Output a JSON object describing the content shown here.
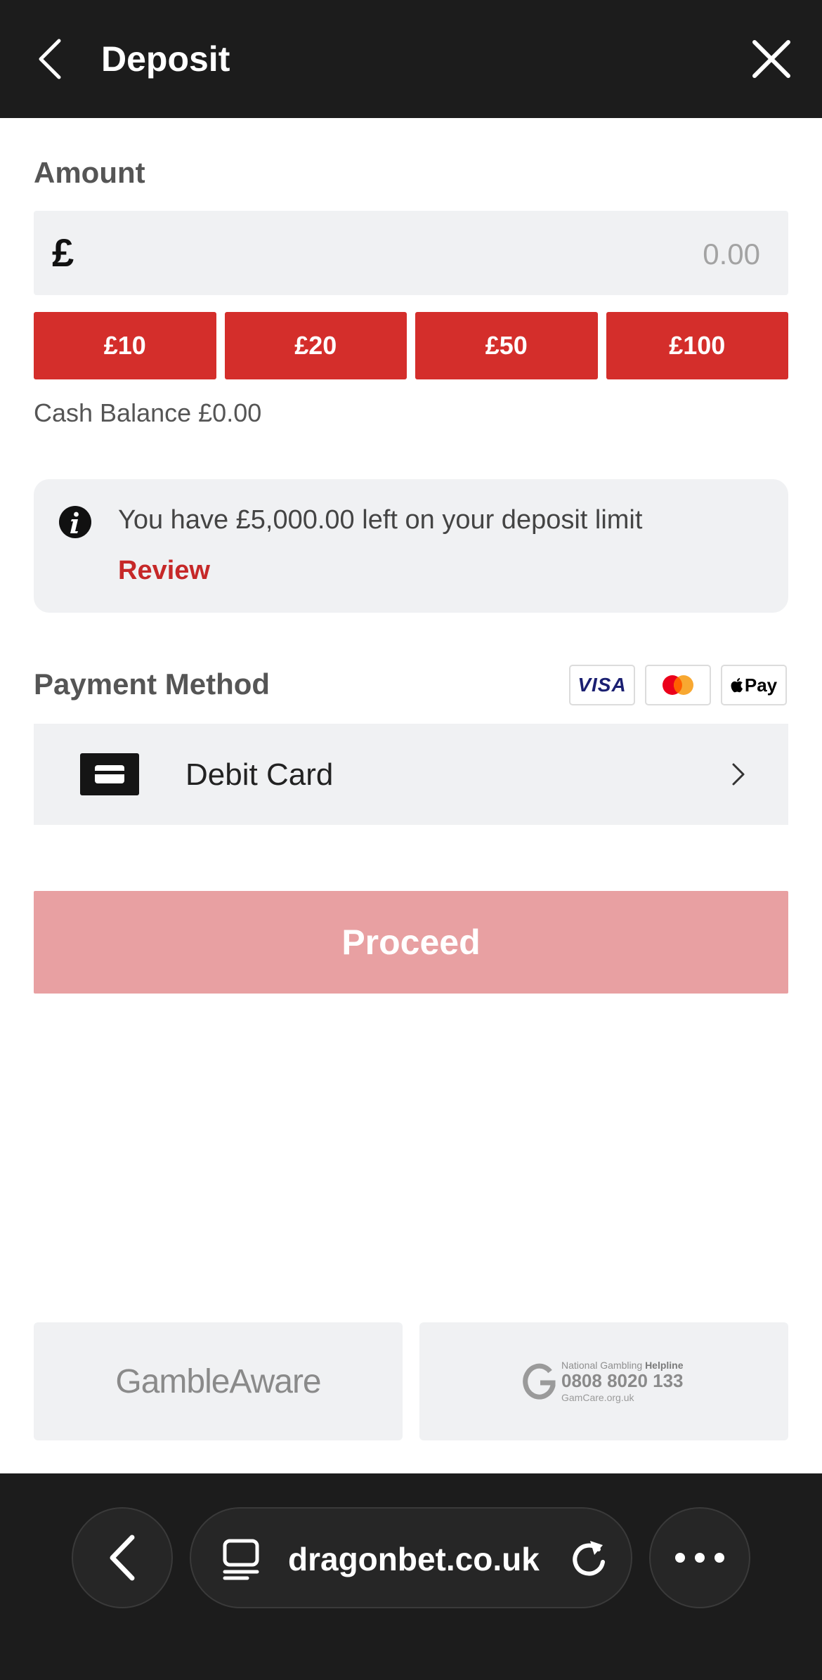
{
  "header": {
    "title": "Deposit"
  },
  "amount": {
    "label": "Amount",
    "currency_symbol": "£",
    "placeholder": "0.00",
    "quick_amounts": [
      "£10",
      "£20",
      "£50",
      "£100"
    ],
    "cash_balance_label": "Cash Balance",
    "cash_balance_value": "£0.00"
  },
  "deposit_limit": {
    "message": "You have £5,000.00 left on your deposit limit",
    "review_label": "Review"
  },
  "payment": {
    "label": "Payment Method",
    "card_logos": [
      "visa-logo",
      "mastercard-logo",
      "apple-pay-logo"
    ],
    "visa_text": "VISA",
    "applepay_text": "Pay",
    "method_label": "Debit Card"
  },
  "proceed_label": "Proceed",
  "footer": {
    "gambleaware": "GambleAware",
    "helpline_line1_prefix": "National Gambling",
    "helpline_line1_bold": "Helpline",
    "helpline_number": "0808 8020 133",
    "helpline_site": "GamCare.org.uk"
  },
  "browser": {
    "url": "dragonbet.co.uk"
  },
  "colors": {
    "header_bg": "#1c1c1c",
    "accent_red": "#d42e2b",
    "review_red": "#c62828",
    "proceed_disabled": "#e8a0a2",
    "panel_grey": "#f0f1f3"
  }
}
